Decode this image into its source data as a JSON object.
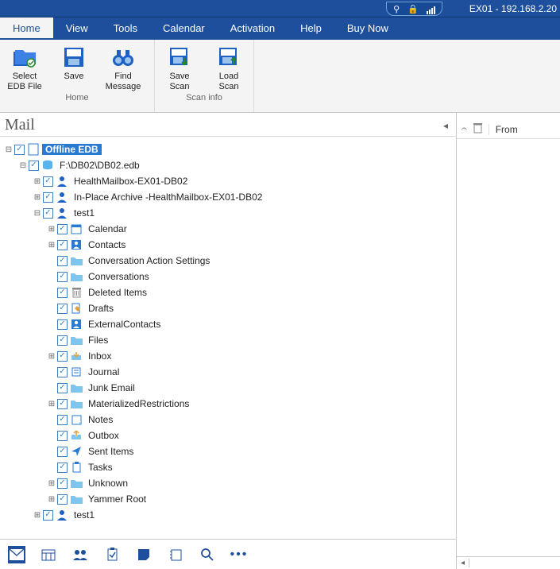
{
  "titlebar": {
    "label": "EX01 - 192.168.2.20"
  },
  "tabs": {
    "home": "Home",
    "view": "View",
    "tools": "Tools",
    "calendar": "Calendar",
    "activation": "Activation",
    "help": "Help",
    "buynow": "Buy Now"
  },
  "ribbon": {
    "group_home": "Home",
    "group_scan": "Scan info",
    "select_edb_1": "Select",
    "select_edb_2": "EDB File",
    "save": "Save",
    "find_1": "Find",
    "find_2": "Message",
    "savescan_1": "Save",
    "savescan_2": "Scan",
    "loadscan_1": "Load",
    "loadscan_2": "Scan"
  },
  "left": {
    "title": "Mail"
  },
  "list": {
    "from": "From"
  },
  "tree": {
    "root": "Offline EDB",
    "db": "F:\\DB02\\DB02.edb",
    "mbx1": "HealthMailbox-EX01-DB02",
    "mbx2": "In-Place Archive -HealthMailbox-EX01-DB02",
    "test1": "test1",
    "test1b": "test1",
    "f": {
      "calendar": "Calendar",
      "contacts": "Contacts",
      "convset": "Conversation Action Settings",
      "convs": "Conversations",
      "deleted": "Deleted Items",
      "drafts": "Drafts",
      "extc": "ExternalContacts",
      "files": "Files",
      "inbox": "Inbox",
      "journal": "Journal",
      "junk": "Junk Email",
      "matrest": "MaterializedRestrictions",
      "notes": "Notes",
      "outbox": "Outbox",
      "sent": "Sent Items",
      "tasks": "Tasks",
      "unknown": "Unknown",
      "yammer": "Yammer Root"
    }
  }
}
